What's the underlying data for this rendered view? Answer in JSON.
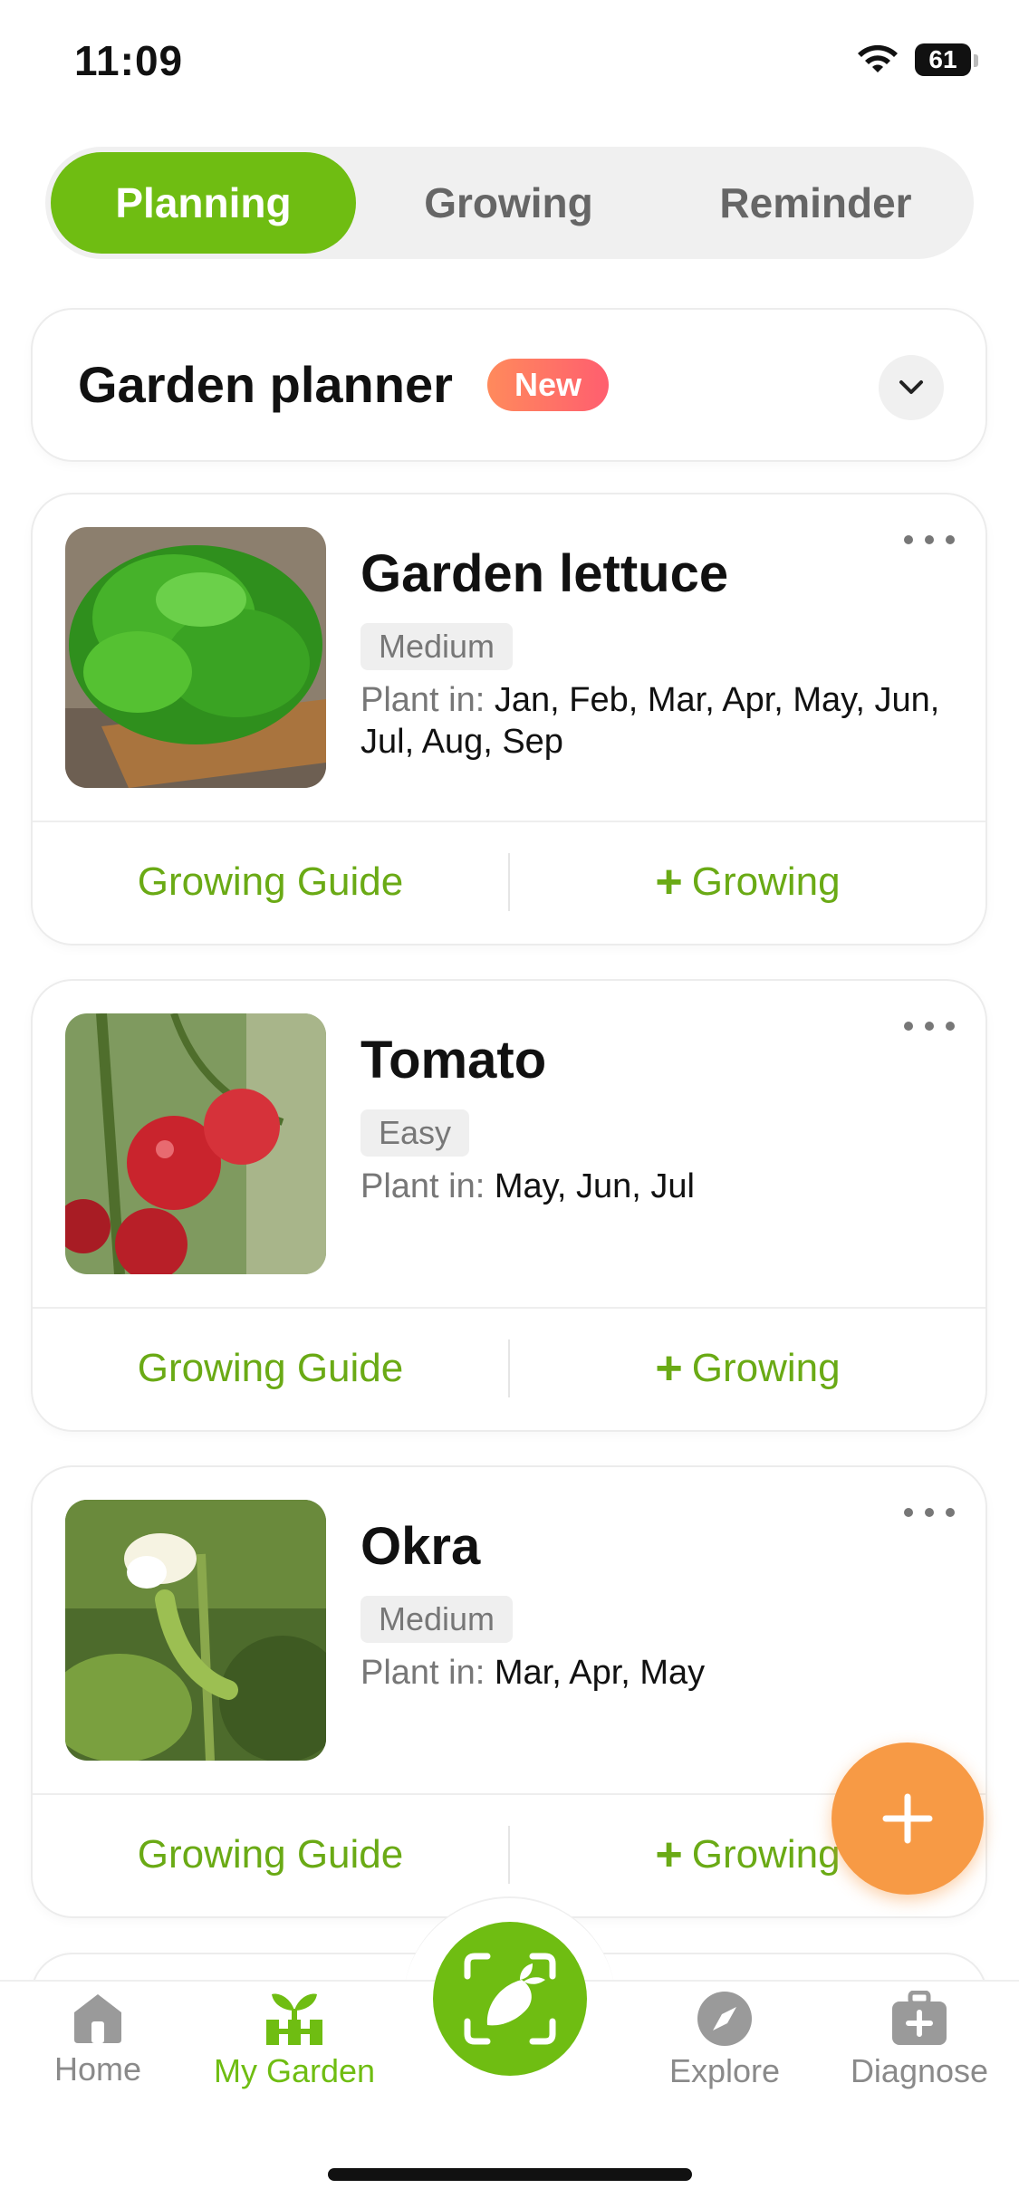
{
  "status_bar": {
    "time": "11:09",
    "battery": "61"
  },
  "segments": {
    "tabs": [
      {
        "label": "Planning"
      },
      {
        "label": "Growing"
      },
      {
        "label": "Reminder"
      }
    ],
    "active": "Planning"
  },
  "planner": {
    "title": "Garden planner",
    "badge": "New"
  },
  "plants": [
    {
      "name": "Garden lettuce",
      "difficulty": "Medium",
      "plant_in_label": "Plant in:",
      "months": "Jan, Feb, Mar, Apr, May, Jun, Jul, Aug, Sep",
      "guide_label": "Growing Guide",
      "growing_label": "Growing"
    },
    {
      "name": "Tomato",
      "difficulty": "Easy",
      "plant_in_label": "Plant in:",
      "months": "May, Jun, Jul",
      "guide_label": "Growing Guide",
      "growing_label": "Growing"
    },
    {
      "name": "Okra",
      "difficulty": "Medium",
      "plant_in_label": "Plant in:",
      "months": "Mar, Apr, May",
      "guide_label": "Growing Guide",
      "growing_label": "Growing"
    }
  ],
  "tabbar": {
    "items": [
      {
        "label": "Home",
        "icon": "home-icon"
      },
      {
        "label": "My Garden",
        "icon": "garden-icon"
      },
      {
        "label": "Explore",
        "icon": "compass-icon"
      },
      {
        "label": "Diagnose",
        "icon": "medkit-icon"
      }
    ],
    "active": "My Garden",
    "center_icon": "plant-scan-icon"
  },
  "colors": {
    "accent": "#6fbd12",
    "action_text": "#6aaa15",
    "fab": "#f79a45",
    "badge_start": "#ff8a5c",
    "badge_end": "#ff5e6f"
  }
}
